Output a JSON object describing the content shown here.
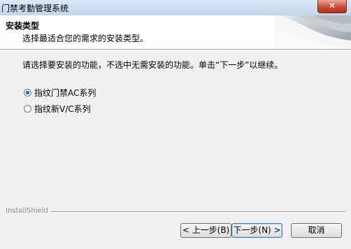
{
  "window": {
    "title": "门禁考勤管理系统",
    "close_label": "✕"
  },
  "header": {
    "title": "安装类型",
    "subtitle": "选择最适合您的需求的安装类型。"
  },
  "main": {
    "instruction": "请选择要安装的功能，不选中无需安装的功能。单击“下一步”以继续。",
    "options": [
      {
        "label": "指纹门禁AC系列",
        "checked": true
      },
      {
        "label": "指纹新V/C系列",
        "checked": false
      }
    ]
  },
  "footer": {
    "brand": "InstallShield",
    "back_label": "< 上一步(B)",
    "next_label": "下一步(N) >",
    "cancel_label": "取消"
  }
}
